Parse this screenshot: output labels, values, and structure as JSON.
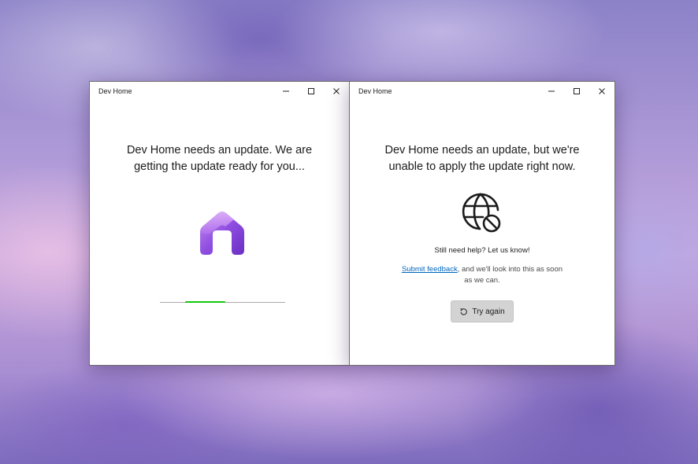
{
  "left_window": {
    "title": "Dev Home",
    "heading_line1": "Dev Home needs an update. We are",
    "heading_line2": "getting the update ready for you...",
    "logo_icon": "dev-home-logo-icon",
    "progress": {
      "start": 0.2,
      "end": 0.52,
      "color": "#16c60c"
    }
  },
  "right_window": {
    "title": "Dev Home",
    "heading_line1": "Dev Home needs an update, but we're",
    "heading_line2": "unable to apply the update right now.",
    "status_icon": "globe-blocked-icon",
    "help_title": "Still need help? Let us know!",
    "feedback_link": "Submit feedback",
    "help_text_rest": ", and we'll look into this as soon as we can.",
    "try_again_label": "Try again",
    "try_again_icon": "refresh-icon",
    "link_color": "#0067c0"
  },
  "window_controls": [
    "minimize-icon",
    "maximize-icon",
    "close-icon"
  ]
}
